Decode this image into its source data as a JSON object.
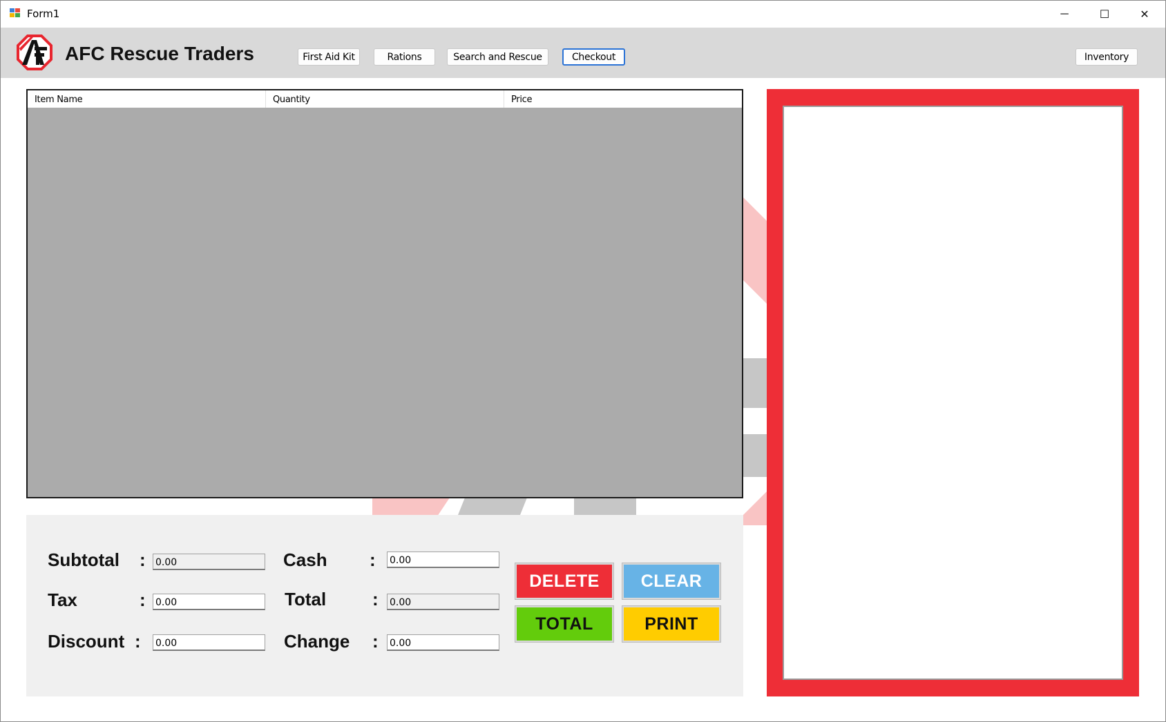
{
  "window": {
    "title": "Form1",
    "app_icon": "windows-form-icon",
    "controls": {
      "minimize": "─",
      "maximize": "☐",
      "close": "✕"
    }
  },
  "header": {
    "brand": "AFC Rescue Traders",
    "logo": "afc-logo-icon",
    "nav": [
      {
        "label": "First Aid Kit"
      },
      {
        "label": "Rations"
      },
      {
        "label": "Search and Rescue"
      },
      {
        "label": "Checkout",
        "active": true
      }
    ],
    "inventory_label": "Inventory"
  },
  "grid": {
    "columns": [
      "Item Name",
      "Quantity",
      "Price"
    ],
    "rows": []
  },
  "totals": {
    "subtotal": {
      "label": "Subtotal",
      "value": "0.00"
    },
    "tax": {
      "label": "Tax",
      "value": "0.00"
    },
    "discount": {
      "label": "Discount",
      "value": "0.00"
    },
    "cash": {
      "label": "Cash",
      "value": "0.00"
    },
    "total": {
      "label": "Total",
      "value": "0.00"
    },
    "change": {
      "label": "Change",
      "value": "0.00"
    },
    "colon": ":"
  },
  "actions": {
    "delete": "DELETE",
    "clear": "CLEAR",
    "total": "TOTAL",
    "print": "PRINT"
  },
  "colors": {
    "header_bg": "#d9d9d9",
    "accent_red": "#ee2e37",
    "clear_blue": "#67b3e6",
    "total_green": "#63cc0c",
    "print_yellow": "#ffcc00",
    "grid_bg": "#ababab",
    "panel_bg": "#f0f0f0"
  },
  "receipt": {
    "text": ""
  }
}
